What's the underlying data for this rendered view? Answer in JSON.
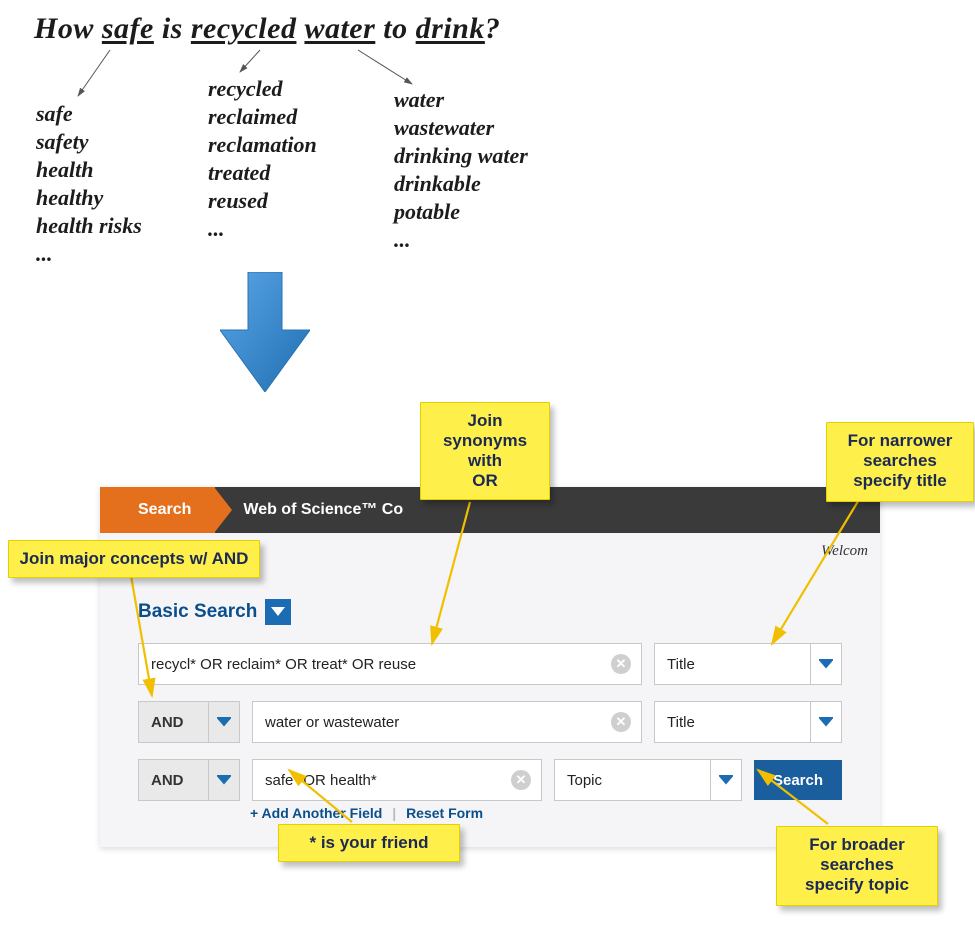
{
  "question": {
    "prefix": "How ",
    "u1": "safe",
    "mid1": " is ",
    "u2": "recycled",
    "mid2": " ",
    "u3": "water",
    "mid3": " to ",
    "u4": "drink",
    "suffix": "?"
  },
  "brainstorm": {
    "col1": "safe\nsafety\nhealth\nhealthy\nhealth risks\n...",
    "col2": "recycled\nreclaimed\nreclamation\ntreated\nreused\n...",
    "col3": "water\nwastewater\ndrinking water\ndrinkable\npotable\n..."
  },
  "panel": {
    "tab_search": "Search",
    "tab_db": "Web of Science™ Co",
    "welcome": "Welcom",
    "basic_search": "Basic Search",
    "rows": [
      {
        "op": "",
        "query": "recycl* OR reclaim* OR treat* OR reuse",
        "field": "Title"
      },
      {
        "op": "AND",
        "query": "water or wastewater",
        "field": "Title"
      },
      {
        "op": "AND",
        "query": "safe* OR health*",
        "field": "Topic"
      }
    ],
    "add_field": "+ Add Another Field",
    "reset_form": "Reset Form",
    "search_btn": "Search"
  },
  "notes": {
    "or": "Join\nsynonyms\nwith\nOR",
    "and": "Join major concepts w/ AND",
    "title": "For narrower\nsearches\nspecify title",
    "star": "* is your friend",
    "topic": "For broader\nsearches\nspecify topic"
  }
}
